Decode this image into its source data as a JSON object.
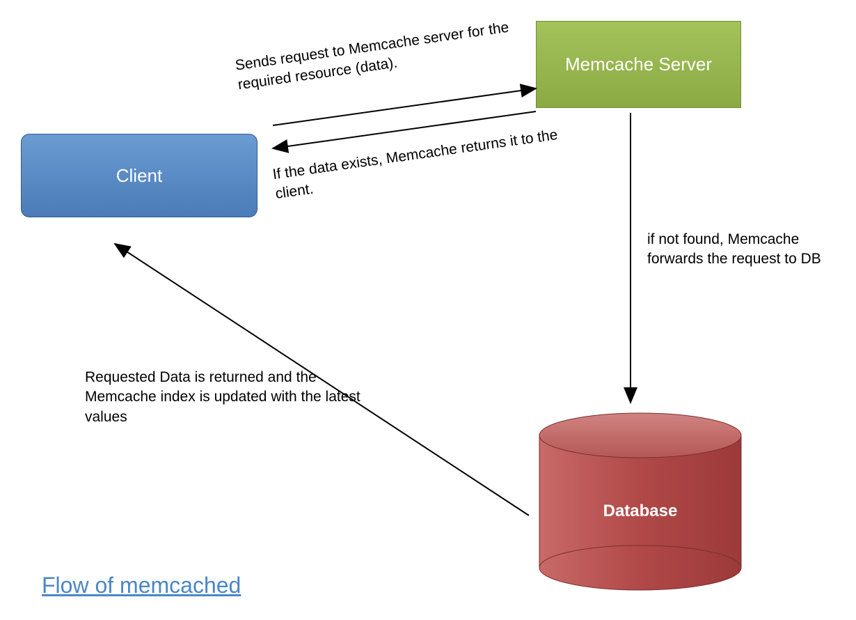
{
  "nodes": {
    "client": "Client",
    "memcache": "Memcache Server",
    "database": "Database"
  },
  "edges": {
    "client_to_memcache": "Sends request to Memcache server for the required resource (data).",
    "memcache_to_client": "If the data exists,\nMemcache returns it to the client.",
    "memcache_to_db": "if not found, Memcache forwards the request to DB",
    "db_to_client": "Requested Data is returned and the Memcache index is updated with the latest values"
  },
  "title": "Flow of memcached",
  "colors": {
    "client": "#4b7cb8",
    "memcache": "#8baa44",
    "database": "#b04948",
    "title": "#4a86c7"
  }
}
